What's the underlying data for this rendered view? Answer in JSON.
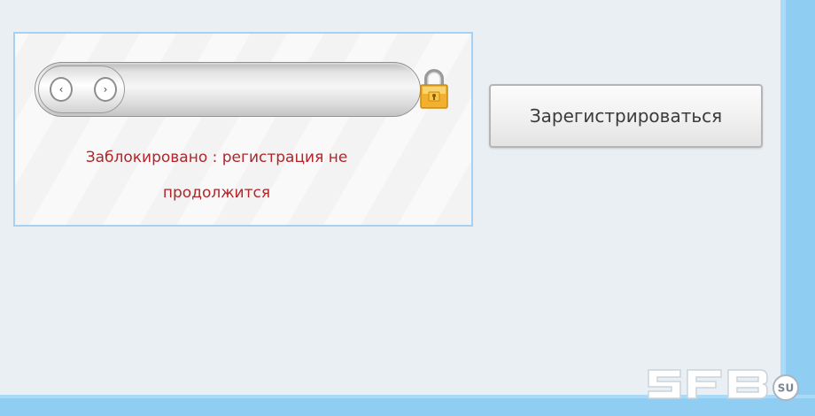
{
  "slider": {
    "left_arrow": "‹",
    "right_arrow": "›",
    "lock_icon": "lock-icon",
    "state": "locked"
  },
  "status": {
    "message_line1": "Заблокировано : регистрация не",
    "message_line2": "продолжится",
    "color": "#b1262a"
  },
  "register_button": {
    "label": "Зарегистрироваться"
  },
  "watermark": {
    "logo_text": "SFB",
    "suffix": "SU"
  },
  "colors": {
    "background": "#eaeff4",
    "frame": "#8fcdf3",
    "box_border": "#a7d1f2"
  }
}
